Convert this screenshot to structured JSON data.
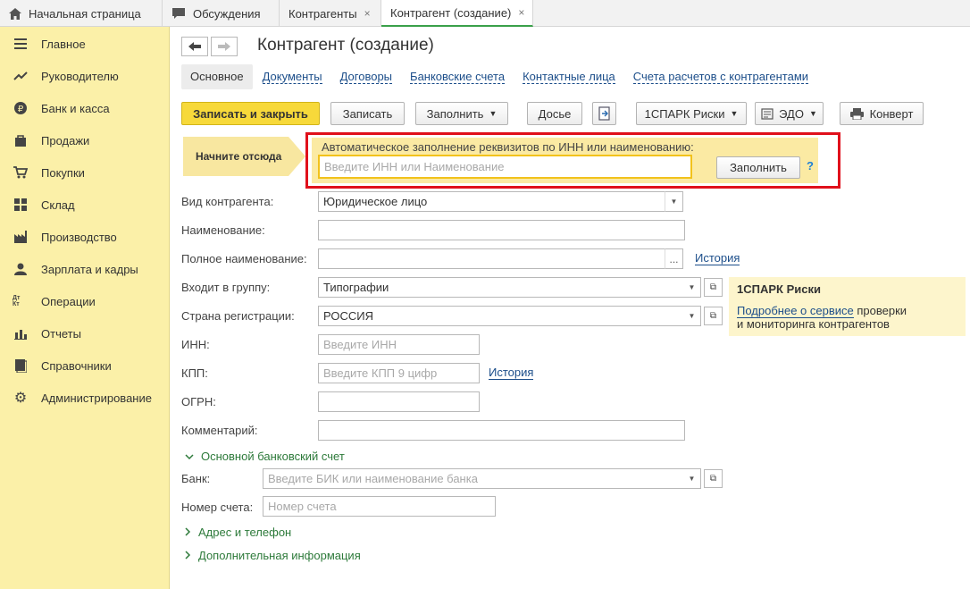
{
  "tabs": [
    {
      "label": "Начальная страница",
      "icon": "home-icon"
    },
    {
      "label": "Обсуждения",
      "icon": "chat-icon"
    },
    {
      "label": "Контрагенты",
      "close": "×"
    },
    {
      "label": "Контрагент (создание)",
      "close": "×"
    }
  ],
  "sidebar": {
    "items": [
      {
        "label": "Главное",
        "icon": "menu-icon"
      },
      {
        "label": "Руководителю",
        "icon": "trend-icon"
      },
      {
        "label": "Банк и касса",
        "icon": "ruble-icon"
      },
      {
        "label": "Продажи",
        "icon": "bag-icon"
      },
      {
        "label": "Покупки",
        "icon": "cart-icon"
      },
      {
        "label": "Склад",
        "icon": "grid-icon"
      },
      {
        "label": "Производство",
        "icon": "factory-icon"
      },
      {
        "label": "Зарплата и кадры",
        "icon": "people-icon"
      },
      {
        "label": "Операции",
        "icon": "dt-kt-icon"
      },
      {
        "label": "Отчеты",
        "icon": "bar-chart-icon"
      },
      {
        "label": "Справочники",
        "icon": "book-icon"
      },
      {
        "label": "Администрирование",
        "icon": "gear-icon"
      }
    ],
    "operations_icon_text": "Дт Кт"
  },
  "header": {
    "title": "Контрагент (создание)"
  },
  "subtabs": [
    "Основное",
    "Документы",
    "Договоры",
    "Банковские счета",
    "Контактные лица",
    "Счета расчетов с контрагентами"
  ],
  "toolbar": {
    "save_close": "Записать и закрыть",
    "save": "Записать",
    "fill": "Заполнить",
    "dossier": "Досье",
    "spark": "1СПАРК Риски",
    "edo": "ЭДО",
    "envelope": "Конверт"
  },
  "autofill": {
    "hint": "Начните отсюда",
    "label": "Автоматическое заполнение реквизитов по ИНН или наименованию:",
    "placeholder": "Введите ИНН или Наименование",
    "button": "Заполнить",
    "help": "?"
  },
  "form": {
    "kind_label": "Вид контрагента:",
    "kind_value": "Юридическое лицо",
    "name_label": "Наименование:",
    "fullname_label": "Полное наименование:",
    "fullname_btn": "...",
    "history": "История",
    "group_label": "Входит в группу:",
    "group_value": "Типографии",
    "country_label": "Страна регистрации:",
    "country_value": "РОССИЯ",
    "inn_label": "ИНН:",
    "inn_placeholder": "Введите ИНН",
    "kpp_label": "КПП:",
    "kpp_placeholder": "Введите КПП 9 цифр",
    "kpp_history": "История",
    "ogrn_label": "ОГРН:",
    "comment_label": "Комментарий:",
    "bank_group": "Основной банковский счет",
    "bank_label": "Банк:",
    "bank_placeholder": "Введите БИК или наименование банка",
    "account_label": "Номер счета:",
    "account_placeholder": "Номер счета",
    "address_group": "Адрес и телефон",
    "extra_group": "Дополнительная информация"
  },
  "spark_panel": {
    "title": "1СПАРК Риски",
    "link": "Подробнее о сервисе",
    "text1": " проверки",
    "text2": "и мониторинга контрагентов"
  },
  "colors": {
    "accent_yellow": "#f7d93a",
    "sidebar": "#fbf0a8",
    "highlight_red": "#e0101b",
    "link": "#1c4e8a",
    "group_green": "#2d7a3a"
  }
}
